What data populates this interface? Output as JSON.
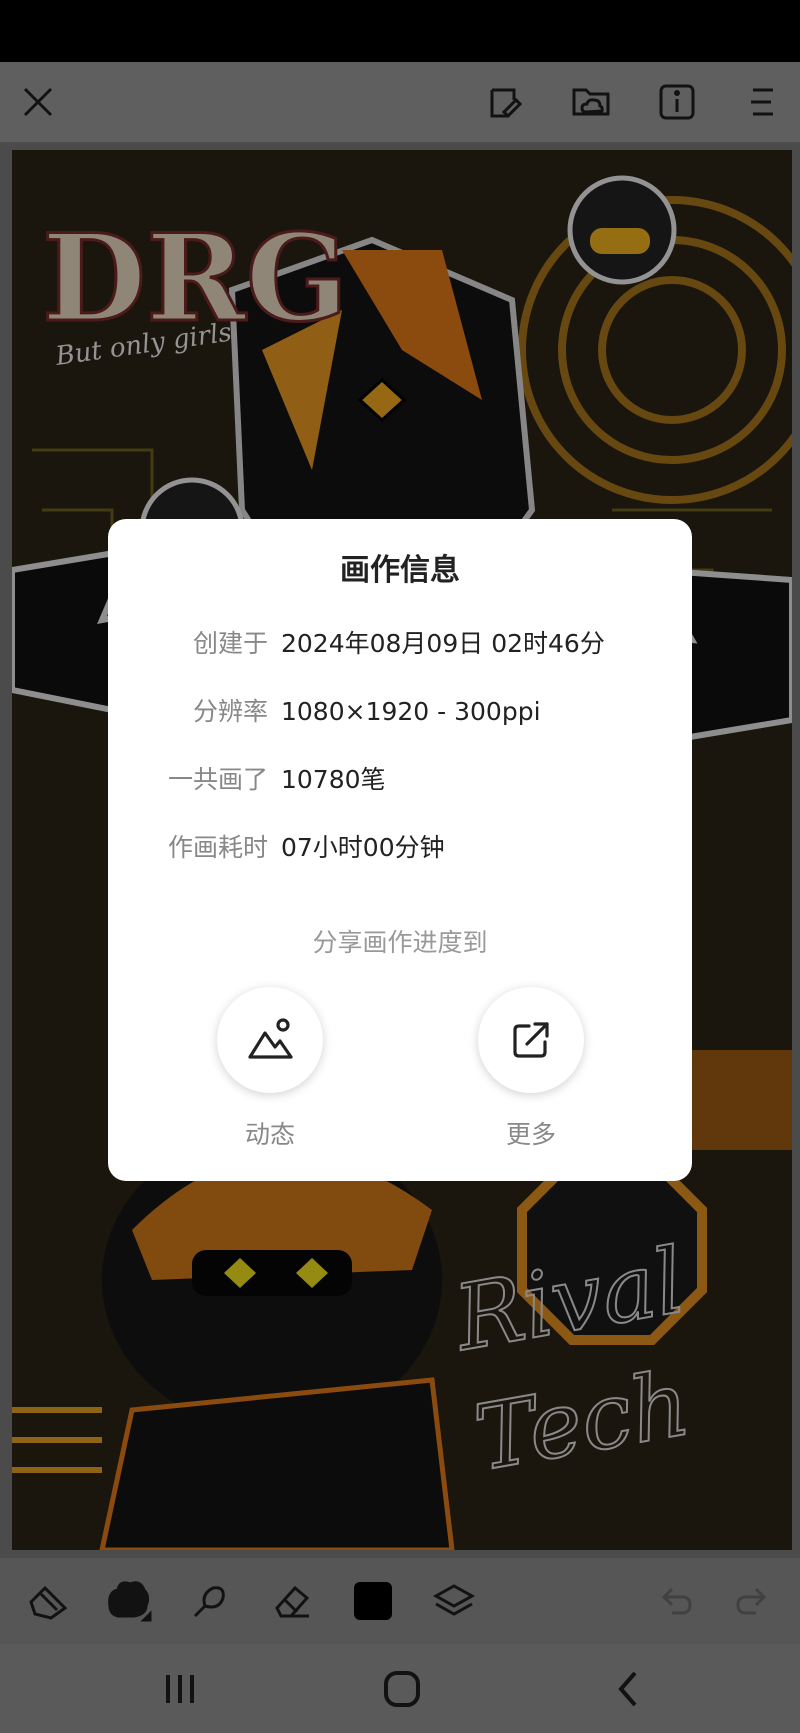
{
  "toolbar": {
    "icons": [
      "close-icon",
      "gallery-note-icon",
      "cloud-folder-icon",
      "info-icon",
      "menu-icon"
    ]
  },
  "canvas": {
    "artwork_texts": [
      "DRG",
      "But only girls",
      "Rival",
      "Tech"
    ]
  },
  "dialog": {
    "title": "画作信息",
    "rows": [
      {
        "label": "创建于",
        "value": "2024年08月09日 02时46分"
      },
      {
        "label": "分辨率",
        "value": "1080×1920 - 300ppi"
      },
      {
        "label": "一共画了",
        "value": "10780笔"
      },
      {
        "label": "作画耗时",
        "value": "07小时00分钟"
      }
    ],
    "share_title": "分享画作进度到",
    "share_options": [
      {
        "label": "动态",
        "icon": "moments-icon"
      },
      {
        "label": "更多",
        "icon": "external-share-icon"
      }
    ]
  },
  "bottom_toolbar": {
    "tools": [
      "shapes-icon",
      "brush-icon",
      "smudge-icon",
      "eraser-icon",
      "color-swatch",
      "layers-icon",
      "undo-icon",
      "redo-icon"
    ],
    "current_color": "#000000"
  },
  "colors": {
    "accent_orange": "#f0a020",
    "dialog_bg": "#ffffff"
  }
}
